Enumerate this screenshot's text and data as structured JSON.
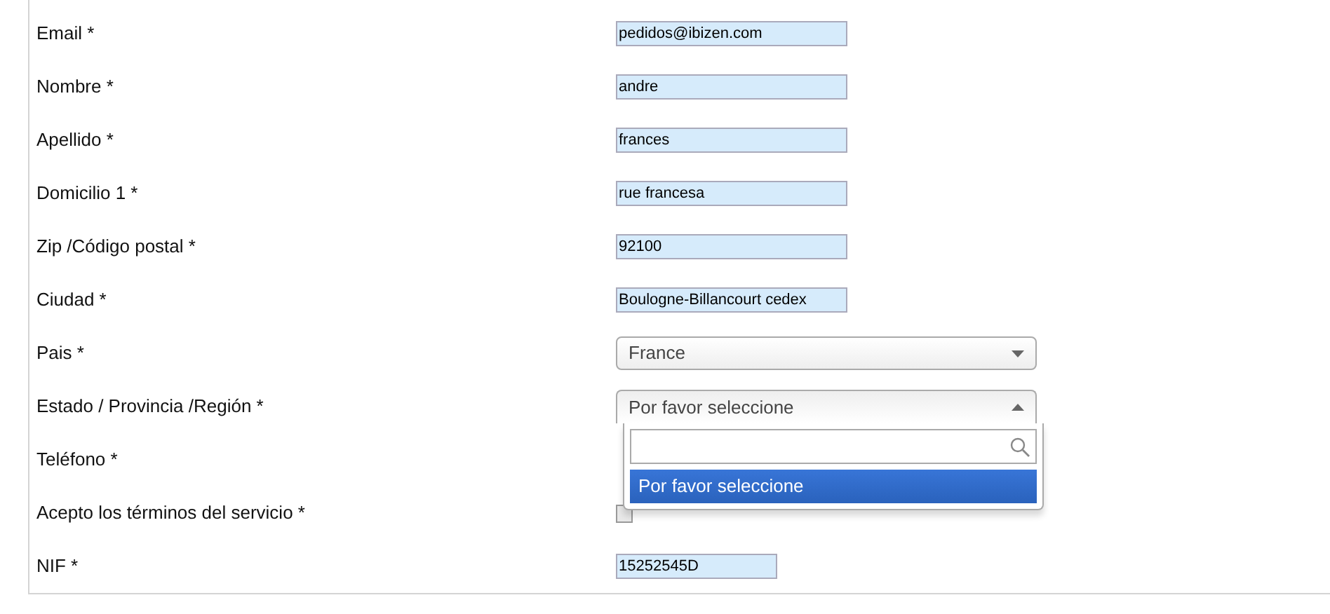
{
  "form": {
    "rows": [
      {
        "label": "Email *",
        "kind": "text",
        "value": "pedidos@ibizen.com"
      },
      {
        "label": "Nombre *",
        "kind": "text",
        "value": "andre"
      },
      {
        "label": "Apellido *",
        "kind": "text",
        "value": "frances"
      },
      {
        "label": "Domicilio 1 *",
        "kind": "text",
        "value": "rue francesa"
      },
      {
        "label": "Zip /Código postal *",
        "kind": "text",
        "value": "92100"
      },
      {
        "label": "Ciudad *",
        "kind": "text",
        "value": "Boulogne-Billancourt cedex"
      },
      {
        "label": "Pais *",
        "kind": "select",
        "value": "France",
        "expanded": false
      },
      {
        "label": "Estado / Provincia /Región *",
        "kind": "select",
        "value": "Por favor seleccione",
        "expanded": true,
        "options": [
          {
            "label": "Por favor seleccione",
            "selected": true
          }
        ]
      },
      {
        "label": "Teléfono *",
        "kind": "covered"
      },
      {
        "label": "Acepto los términos del servicio *",
        "kind": "checkbox",
        "checked": false
      },
      {
        "label": "NIF *",
        "kind": "short_text",
        "value": "15252545D"
      }
    ]
  }
}
